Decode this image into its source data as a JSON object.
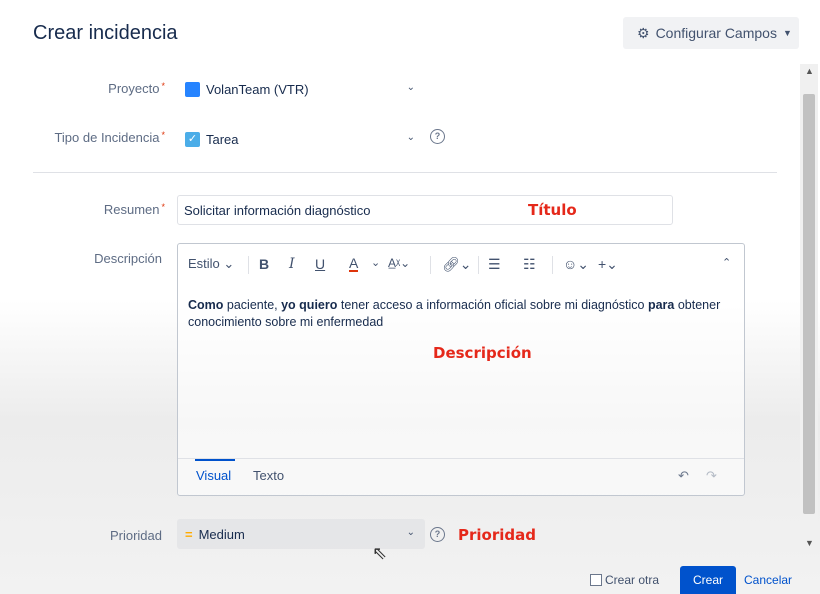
{
  "dialog": {
    "title": "Crear incidencia",
    "configure_label": "Configurar Campos"
  },
  "fields": {
    "project": {
      "label": "Proyecto",
      "value": "VolanTeam (VTR)"
    },
    "issue_type": {
      "label": "Tipo de Incidencia",
      "value": "Tarea"
    },
    "summary": {
      "label": "Resumen",
      "value": "Solicitar información diagnóstico"
    },
    "description": {
      "label": "Descripción",
      "text_parts": [
        "Como",
        " paciente, ",
        "yo quiero",
        " tener acceso a información oficial sobre mi diagnóstico ",
        "para",
        " obtener conocimiento sobre mi enfermedad"
      ]
    },
    "priority": {
      "label": "Prioridad",
      "value": "Medium"
    }
  },
  "editor": {
    "style_label": "Estilo",
    "tabs": [
      "Visual",
      "Texto"
    ]
  },
  "annotations": {
    "title": "Título",
    "description": "Descripción",
    "priority": "Prioridad"
  },
  "footer": {
    "create_another": "Crear otra",
    "create": "Crear",
    "cancel": "Cancelar"
  },
  "colors": {
    "primary": "#0052cc",
    "annotation": "#e5281a",
    "priority_medium": "#ffab00"
  }
}
